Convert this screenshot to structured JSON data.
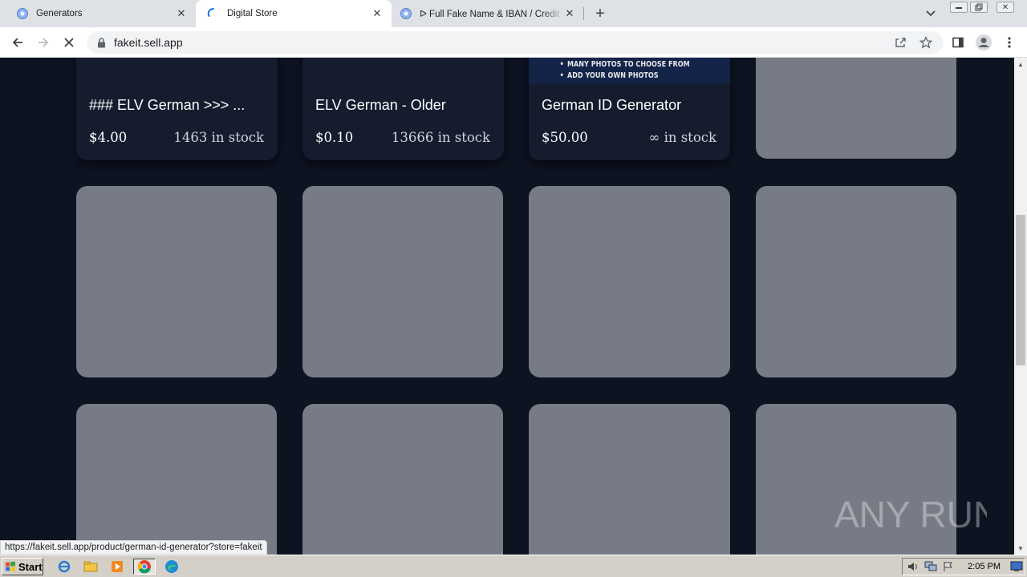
{
  "browser": {
    "tabs": [
      {
        "title": "Generators",
        "active": false
      },
      {
        "title": "Digital Store",
        "active": true
      },
      {
        "title": "ᐅ Full Fake Name & IBAN / Credit Ca",
        "active": false
      }
    ],
    "url": "fakeit.sell.app",
    "status_url": "https://fakeit.sell.app/product/german-id-generator?store=fakeit"
  },
  "products": [
    {
      "name": "### ELV German >>> ...",
      "price": "$4.00",
      "stock": "1463 in stock"
    },
    {
      "name": "ELV German - Older",
      "price": "$0.10",
      "stock": "13666 in stock"
    },
    {
      "name": "German ID Generator",
      "price": "$50.00",
      "stock": "∞ in stock",
      "promo_lines": [
        "MANY PHOTOS TO CHOOSE FROM",
        "ADD YOUR OWN PHOTOS"
      ]
    }
  ],
  "watermark": "ANY RUN",
  "taskbar": {
    "start_label": "Start",
    "clock": "2:05 PM"
  },
  "colors": {
    "page_bg": "#0d1321",
    "card_bg": "#141c2e",
    "placeholder": "#767b85"
  }
}
